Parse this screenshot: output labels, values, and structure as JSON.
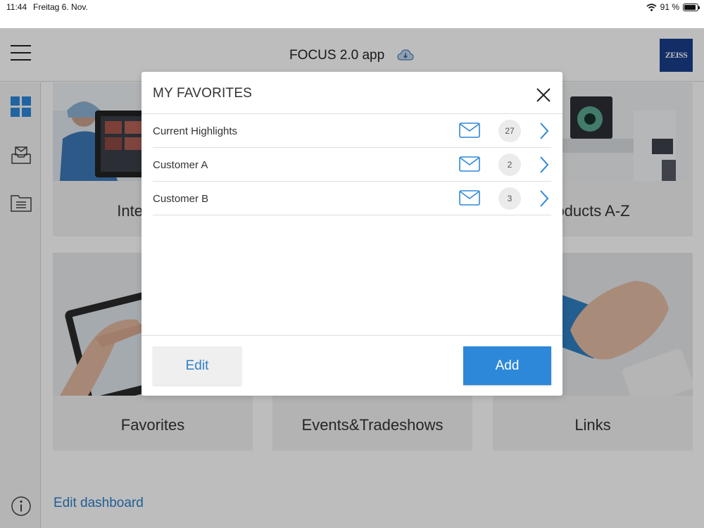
{
  "status_bar": {
    "time": "11:44",
    "date": "Freitag 6. Nov.",
    "battery": "91 %",
    "battery_level": 0.91
  },
  "header": {
    "title": "FOCUS 2.0 app",
    "logo": "ZEISS"
  },
  "tiles": [
    {
      "label": "Interactive"
    },
    {
      "label": "oducts A-Z"
    },
    {
      "label": "Favorites"
    },
    {
      "label": "Events&Tradeshows"
    },
    {
      "label": "Links"
    }
  ],
  "edit_dashboard": "Edit dashboard",
  "modal": {
    "title": "MY FAVORITES",
    "items": [
      {
        "label": "Current Highlights",
        "count": "27"
      },
      {
        "label": "Customer A",
        "count": "2"
      },
      {
        "label": "Customer B",
        "count": "3"
      }
    ],
    "edit_label": "Edit",
    "add_label": "Add"
  },
  "colors": {
    "accent": "#2d88d9",
    "link": "#2d7fc7",
    "zeiss_blue": "#1a3e8c"
  }
}
